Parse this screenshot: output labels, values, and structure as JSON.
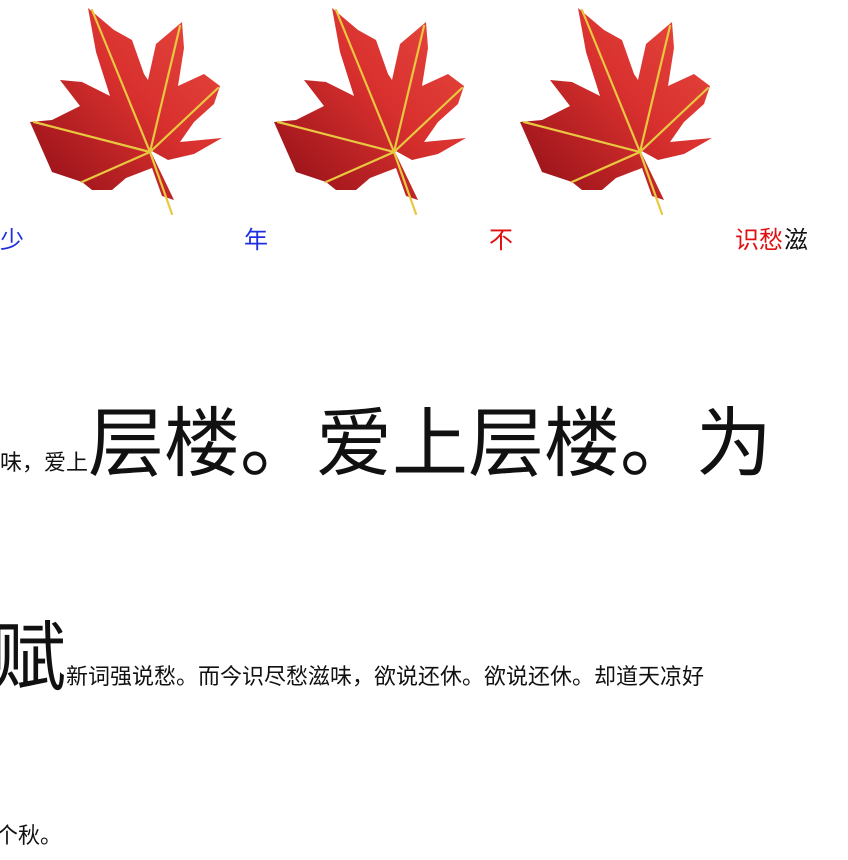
{
  "colors": {
    "blue_text": "#1f2fe0",
    "red_text": "#e01010",
    "body_text": "#111111",
    "leaf_light": "#e0403a",
    "leaf_dark": "#9a1018",
    "vein": "#e8c840"
  },
  "images": [
    {
      "name": "maple-leaf-image"
    },
    {
      "name": "maple-leaf-image"
    },
    {
      "name": "maple-leaf-image"
    }
  ],
  "row1": {
    "char1": "少",
    "char2": "年",
    "char3": "不",
    "char4_red": "识愁",
    "char4_black": "滋"
  },
  "line2": {
    "small": "味，爱上",
    "big": "层楼。爱上层楼。为"
  },
  "line3": {
    "big": "赋",
    "small": "新词强说愁。而今识尽愁滋味，欲说还休。欲说还休。却道天凉好"
  },
  "line4": {
    "small": "个秋。"
  }
}
